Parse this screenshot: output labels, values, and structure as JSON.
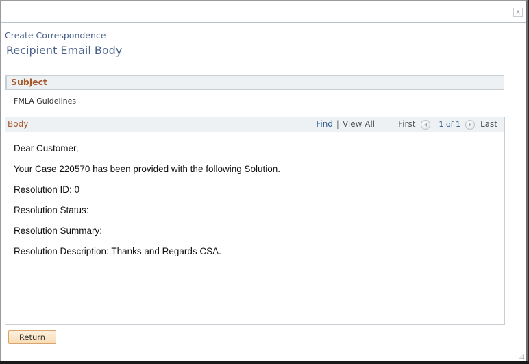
{
  "window": {
    "close_label": "x"
  },
  "header": {
    "breadcrumb": "Create Correspondence",
    "title": "Recipient Email Body"
  },
  "subject": {
    "label": "Subject",
    "value": "FMLA Guidelines"
  },
  "body": {
    "label": "Body",
    "nav": {
      "find": "Find",
      "separator": "|",
      "view_all": "View All",
      "first": "First",
      "count": "1 of 1",
      "last": "Last"
    },
    "lines": [
      "Dear Customer,",
      "Your Case 220570 has been provided with the following Solution.",
      "Resolution ID: 0",
      "Resolution Status:",
      "Resolution Summary:",
      "Resolution Description: Thanks and Regards CSA."
    ]
  },
  "footer": {
    "return_label": "Return"
  },
  "colors": {
    "title_blue": "#4a6189",
    "section_label": "#a5582b",
    "link_blue": "#2c5a8f",
    "button_bg": "#f9dcb4"
  }
}
